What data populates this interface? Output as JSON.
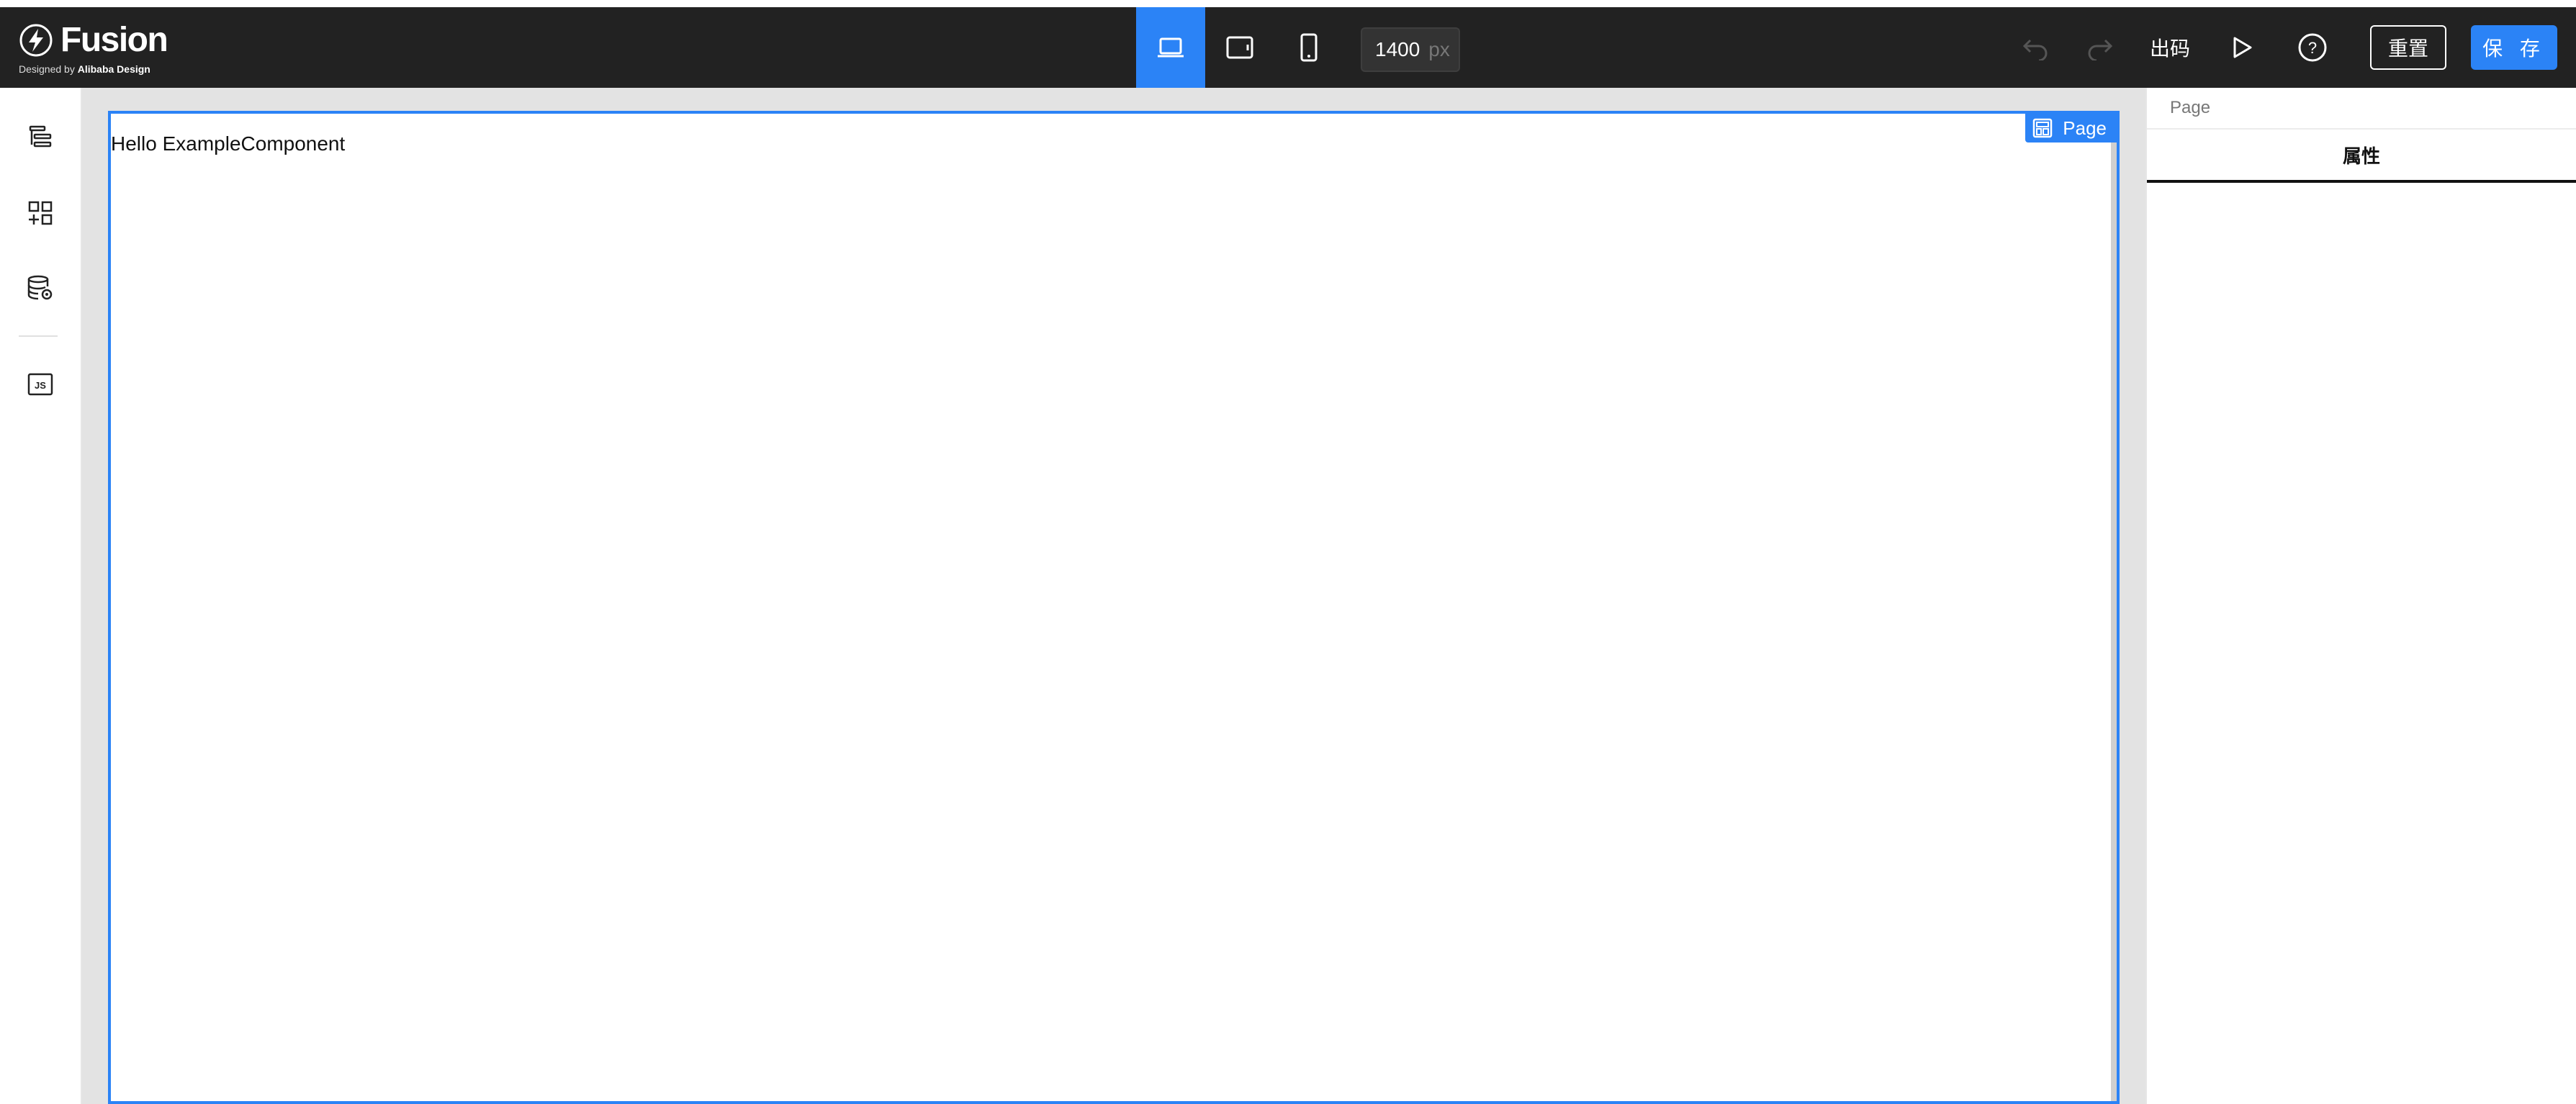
{
  "brand": {
    "name": "Fusion",
    "tagline_prefix": "Designed by",
    "tagline_brand": "Alibaba Design"
  },
  "toolbar": {
    "devices": [
      {
        "icon": "desktop-icon",
        "active": true
      },
      {
        "icon": "tablet-icon",
        "active": false
      },
      {
        "icon": "mobile-icon",
        "active": false
      }
    ],
    "canvas_width_value": "1400",
    "canvas_width_unit": "px",
    "code_label": "出码",
    "reset_label": "重置",
    "save_label": "保 存",
    "accent_color": "#2b83f6"
  },
  "sidebar": {
    "items": [
      {
        "icon": "outline-tree-icon"
      },
      {
        "icon": "component-library-icon"
      },
      {
        "icon": "data-source-icon"
      },
      {
        "icon": "js-code-icon"
      }
    ]
  },
  "canvas": {
    "content_text": "Hello ExampleComponent",
    "selected_badge_label": "Page"
  },
  "right_panel": {
    "breadcrumb": "Page",
    "tab_label": "属性"
  }
}
